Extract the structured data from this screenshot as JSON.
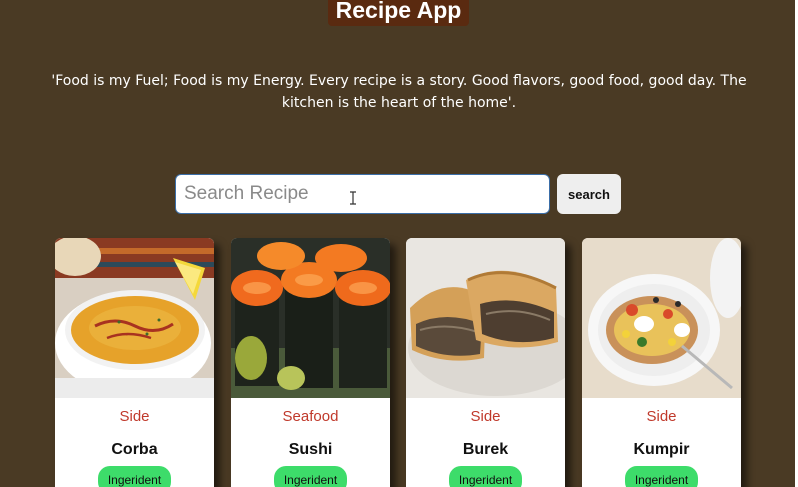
{
  "header": {
    "title": "Recipe App",
    "tagline": "'Food is my Fuel; Food is my Energy. Every recipe is a story. Good flavors, good food, good day. The kitchen is the heart of the home'."
  },
  "search": {
    "placeholder": "Search Recipe",
    "value": "",
    "button_label": "search"
  },
  "recipes": [
    {
      "category": "Side",
      "name": "Corba",
      "button_label": "Ingerident",
      "image": "soup-image"
    },
    {
      "category": "Seafood",
      "name": "Sushi",
      "button_label": "Ingerident",
      "image": "sushi-image"
    },
    {
      "category": "Side",
      "name": "Burek",
      "button_label": "Ingerident",
      "image": "pastry-image"
    },
    {
      "category": "Side",
      "name": "Kumpir",
      "button_label": "Ingerident",
      "image": "stuffed-potato-image"
    }
  ],
  "colors": {
    "background": "#4a3a24",
    "title_bg": "#5a2a10",
    "category_text": "#c0392b",
    "ingredient_button": "#3ddc6a"
  }
}
